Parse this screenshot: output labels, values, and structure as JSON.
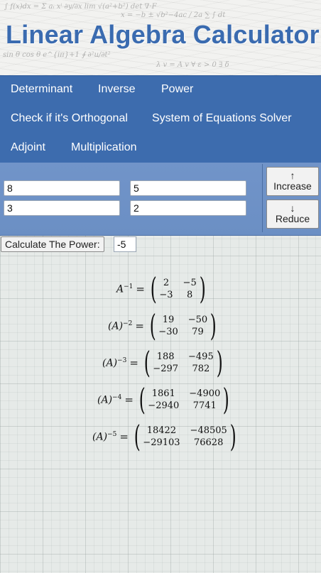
{
  "header": {
    "title": "Linear Algebra Calculator"
  },
  "nav": {
    "items": [
      "Determinant",
      "Inverse",
      "Power",
      "Check if it's Orthogonal",
      "System of Equations Solver",
      "Adjoint",
      "Multiplication"
    ]
  },
  "matrix": {
    "cells": [
      "8",
      "5",
      "3",
      "2"
    ]
  },
  "buttons": {
    "increase_arrow": "↑",
    "increase_label": "Increase",
    "reduce_arrow": "↓",
    "reduce_label": "Reduce"
  },
  "power": {
    "button_label": "Calculate The Power:",
    "value": "-5"
  },
  "results": [
    {
      "lhs": "A",
      "exp": "−1",
      "paren": false,
      "m": [
        "2",
        "−5",
        "−3",
        "8"
      ]
    },
    {
      "lhs": "(A)",
      "exp": "−2",
      "paren": true,
      "m": [
        "19",
        "−50",
        "−30",
        "79"
      ]
    },
    {
      "lhs": "(A)",
      "exp": "−3",
      "paren": true,
      "m": [
        "188",
        "−495",
        "−297",
        "782"
      ]
    },
    {
      "lhs": "(A)",
      "exp": "−4",
      "paren": true,
      "m": [
        "1861",
        "−4900",
        "−2940",
        "7741"
      ]
    },
    {
      "lhs": "(A)",
      "exp": "−5",
      "paren": true,
      "m": [
        "18422",
        "−48505",
        "−29103",
        "76628"
      ]
    }
  ]
}
